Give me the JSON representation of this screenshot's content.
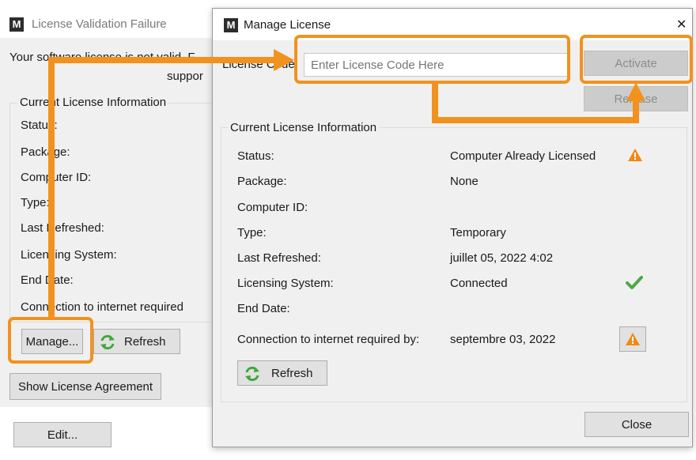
{
  "back_window": {
    "title": "License Validation Failure",
    "message_line1": "Your software license is not valid. F",
    "message_line2": "suppor",
    "group_title": "Current License Information",
    "labels": [
      "Status:",
      "Package:",
      "Computer ID:",
      "Type:",
      "Last Refreshed:",
      "Licensing System:",
      "End Date:"
    ],
    "connection_label": "Connection to internet required",
    "manage_button": "Manage...",
    "refresh_button": "Refresh",
    "show_agreement_button": "Show License Agreement",
    "edit_button": "Edit..."
  },
  "dialog": {
    "title": "Manage License",
    "close_glyph": "✕",
    "license_code_label": "License Code",
    "license_code_value": "",
    "license_code_placeholder": "Enter License Code Here",
    "activate_button": "Activate",
    "release_button": "Release",
    "group_title": "Current License Information",
    "rows": [
      {
        "label": "Status:",
        "value": "Computer Already Licensed"
      },
      {
        "label": "Package:",
        "value": "None"
      },
      {
        "label": "Computer ID:",
        "value": ""
      },
      {
        "label": "Type:",
        "value": "Temporary"
      },
      {
        "label": "Last Refreshed:",
        "value": "juillet 05, 2022 4:02"
      },
      {
        "label": "Licensing System:",
        "value": "Connected"
      },
      {
        "label": "End Date:",
        "value": ""
      }
    ],
    "connection_label": "Connection to internet required by:",
    "connection_value": "septembre 03, 2022",
    "refresh_button": "Refresh",
    "close_button": "Close"
  },
  "icons": {
    "status": "warning-icon",
    "licensing_system": "checkmark-icon",
    "connection": "warning-icon",
    "refresh": "refresh-icon"
  },
  "colors": {
    "highlight": "#f2921d",
    "warning": "#ef8a14",
    "check": "#4fa84a",
    "refresh": "#3da83a"
  }
}
